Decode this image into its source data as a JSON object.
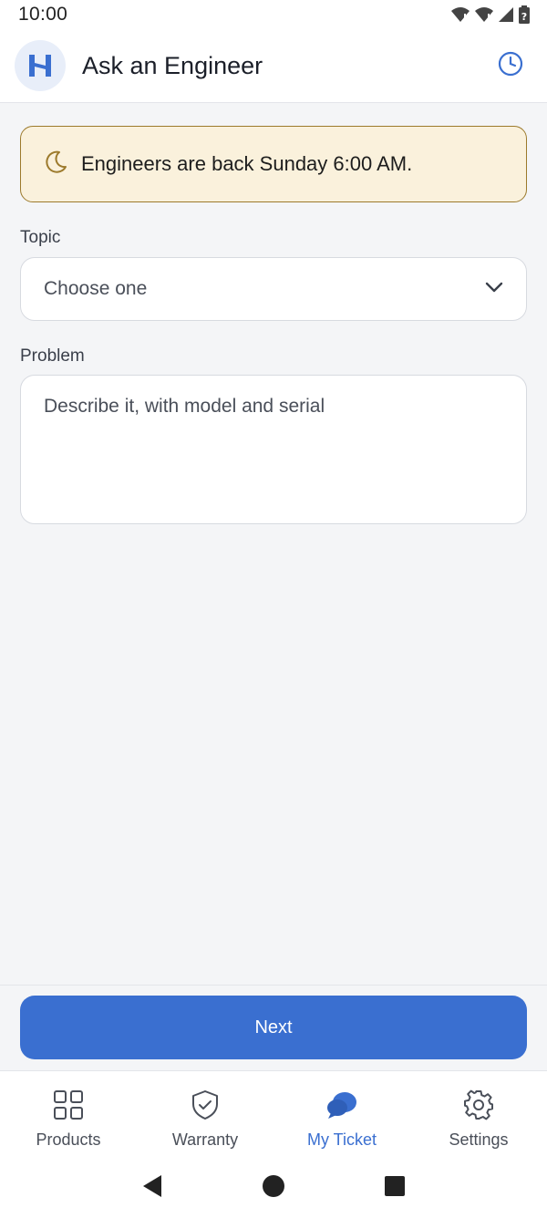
{
  "status_bar": {
    "time": "10:00",
    "icons": [
      "wifi-alert-icon",
      "signal-alert-icon",
      "cell-signal-icon",
      "battery-alert-icon"
    ]
  },
  "app_bar": {
    "title": "Ask an Engineer",
    "logo_icon": "brand-logo-icon",
    "history_icon": "clock-icon"
  },
  "notice": {
    "icon": "moon-icon",
    "text": "Engineers are back Sunday 6:00 AM."
  },
  "form": {
    "topic_label": "Topic",
    "topic_value": "Choose one",
    "problem_label": "Problem",
    "problem_placeholder": "Describe it, with model and serial"
  },
  "actions": {
    "next_label": "Next"
  },
  "bottom_nav": {
    "items": [
      {
        "label": "Products",
        "icon": "grid-icon",
        "active": false
      },
      {
        "label": "Warranty",
        "icon": "shield-check-icon",
        "active": false
      },
      {
        "label": "My Ticket",
        "icon": "chat-bubbles-icon",
        "active": true
      },
      {
        "label": "Settings",
        "icon": "gear-icon",
        "active": false
      }
    ]
  },
  "colors": {
    "accent": "#3a6fd0",
    "notice_bg": "#faf1dc",
    "notice_border": "#9c7a2c",
    "page_bg": "#f4f5f7"
  }
}
